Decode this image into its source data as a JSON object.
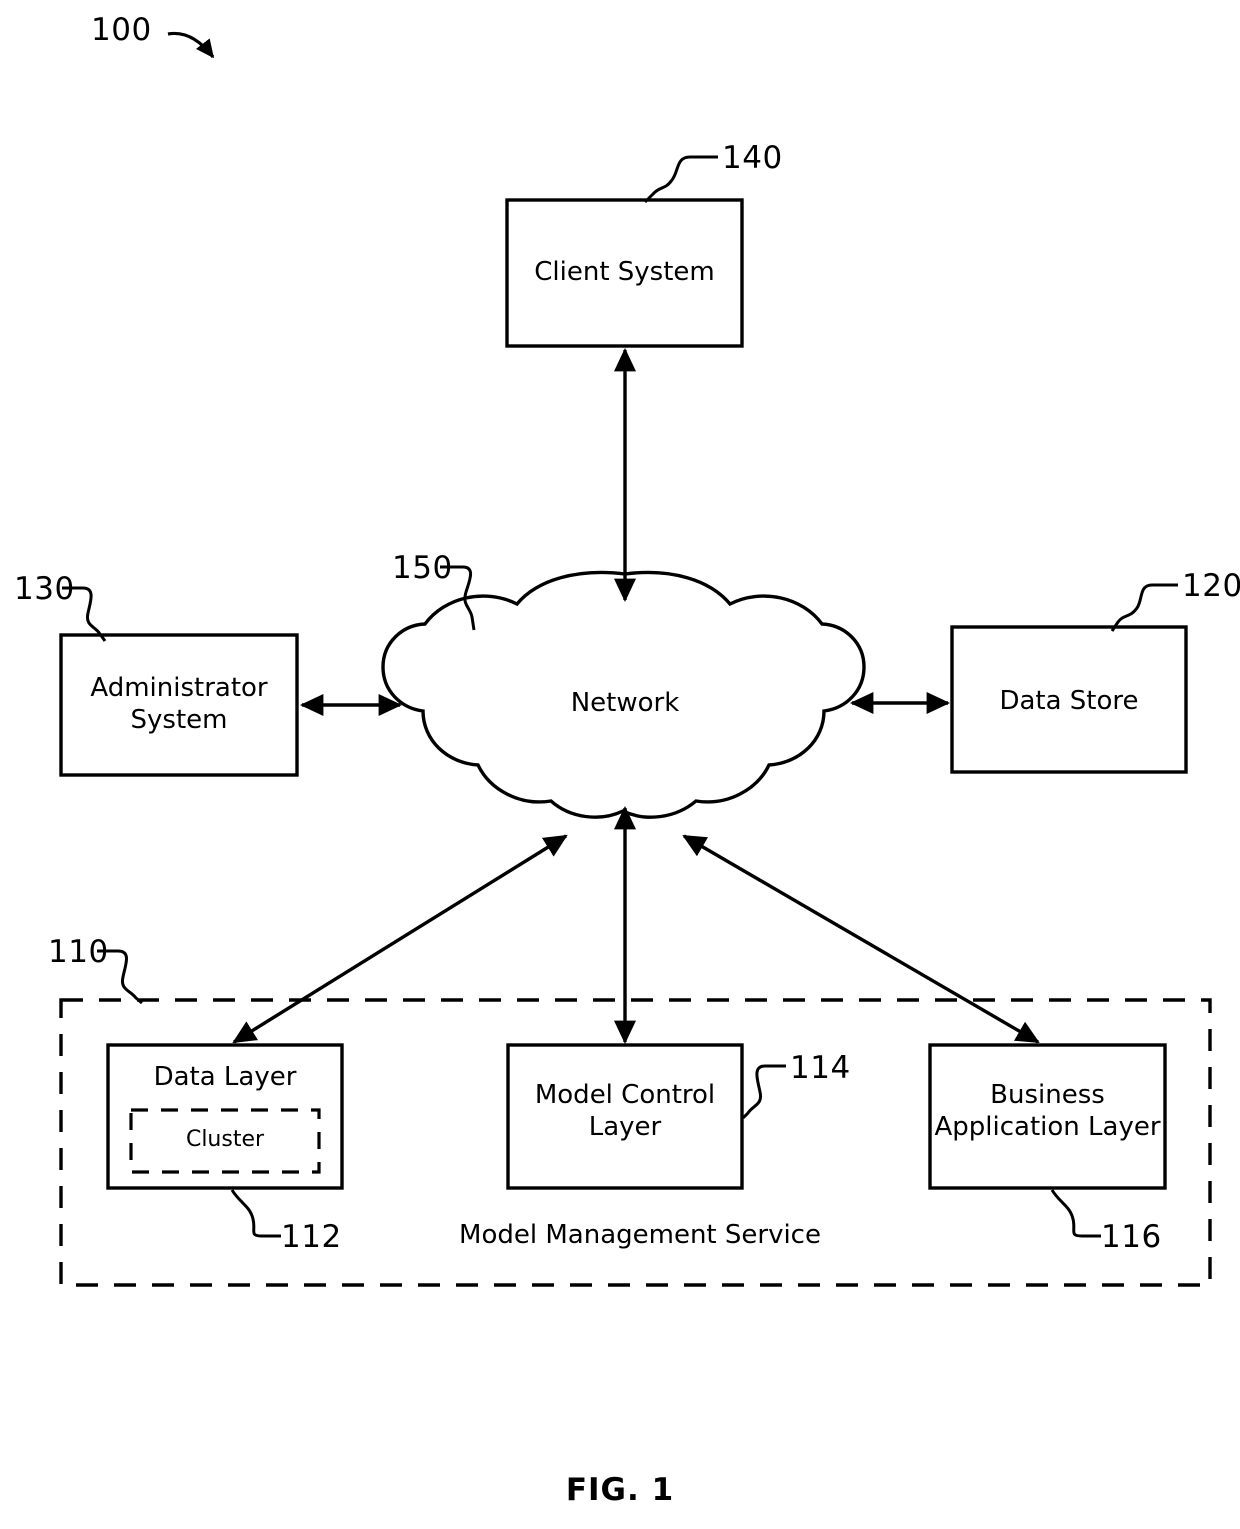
{
  "figure": {
    "caption": "FIG. 1",
    "system_ref": "100"
  },
  "nodes": {
    "client_system": {
      "label": "Client System",
      "ref": "140"
    },
    "network": {
      "label": "Network",
      "ref": "150"
    },
    "administrator_system": {
      "label": "Administrator\nSystem",
      "ref": "130"
    },
    "data_store": {
      "label": "Data Store",
      "ref": "120"
    },
    "model_management_service": {
      "label": "Model Management Service",
      "ref": "110"
    },
    "data_layer": {
      "label": "Data Layer",
      "ref": "112"
    },
    "cluster": {
      "label": "Cluster"
    },
    "model_control_layer": {
      "label": "Model Control\nLayer",
      "ref": "114"
    },
    "business_application_layer": {
      "label": "Business\nApplication Layer",
      "ref": "116"
    }
  },
  "colors": {
    "stroke": "#000000",
    "background": "#ffffff"
  }
}
